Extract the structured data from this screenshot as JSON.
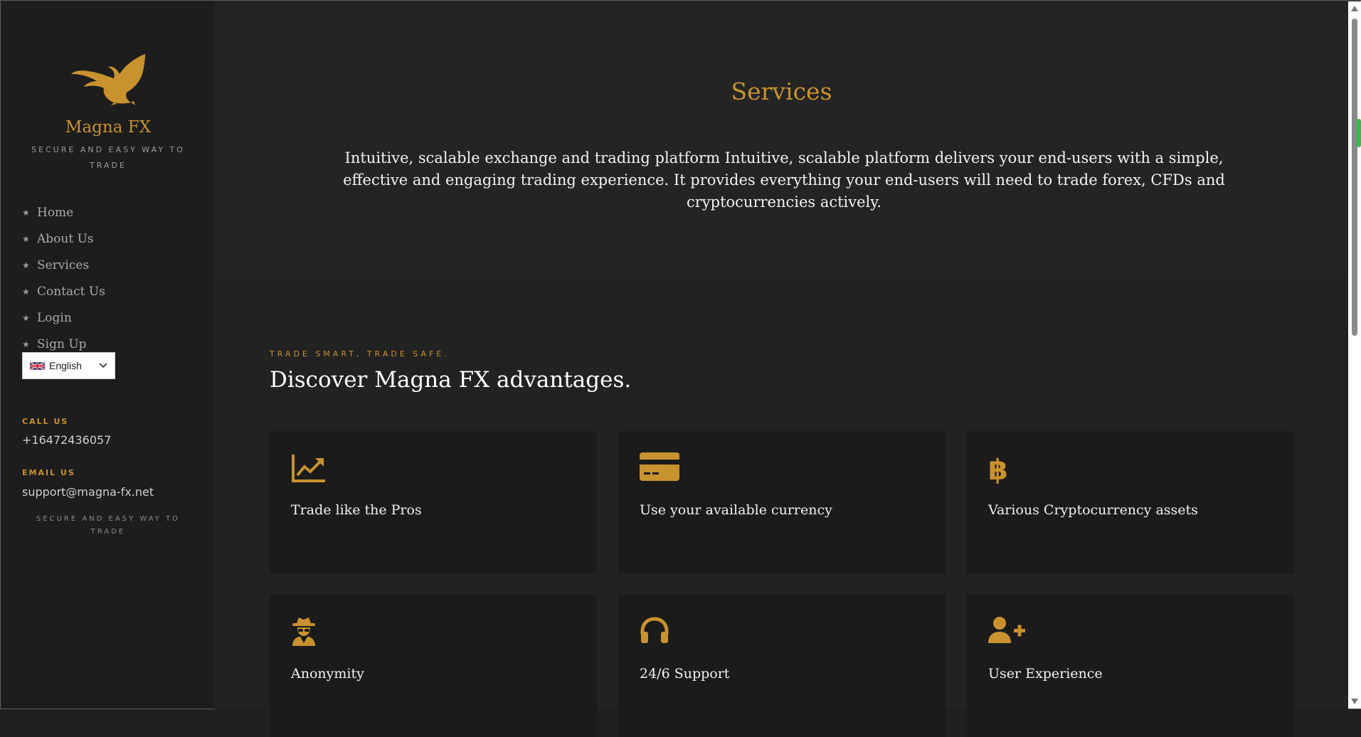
{
  "brand": {
    "name": "Magna FX",
    "tagline": "SECURE AND EASY WAY TO TRADE"
  },
  "nav": {
    "items": [
      {
        "label": "Home"
      },
      {
        "label": "About Us"
      },
      {
        "label": "Services"
      },
      {
        "label": "Contact Us"
      },
      {
        "label": "Login"
      },
      {
        "label": "Sign Up"
      }
    ],
    "bullet": "★"
  },
  "language": {
    "selected": "English",
    "flag_icon": "uk-flag-icon"
  },
  "contact": {
    "call_heading": "CALL US",
    "phone": "+16472436057",
    "email_heading": "EMAIL US",
    "email": "support@magna-fx.net",
    "footer_tagline": "SECURE AND EASY WAY TO TRADE"
  },
  "hero": {
    "title": "Services",
    "text": "Intuitive, scalable exchange and trading platform Intuitive, scalable platform delivers your end-users with a simple, effective and engaging trading experience. It provides everything your end-users will need to trade forex, CFDs and cryptocurrencies actively."
  },
  "advantages": {
    "eyebrow": "TRADE SMART, TRADE SAFE.",
    "title": "Discover Magna FX advantages.",
    "cards": [
      {
        "title": "Trade like the Pros",
        "icon": "chart-line-icon"
      },
      {
        "title": "Use your available currency",
        "icon": "credit-card-icon"
      },
      {
        "title": "Various Cryptocurrency assets",
        "icon": "bitcoin-icon"
      },
      {
        "title": "Anonymity",
        "icon": "user-secret-icon"
      },
      {
        "title": "24/6 Support",
        "icon": "headphones-icon"
      },
      {
        "title": "User Experience",
        "icon": "user-plus-icon"
      }
    ]
  },
  "colors": {
    "accent": "#c8922e",
    "background": "#232323",
    "sidebar": "#1d1d1d",
    "card": "#1b1b1b"
  }
}
